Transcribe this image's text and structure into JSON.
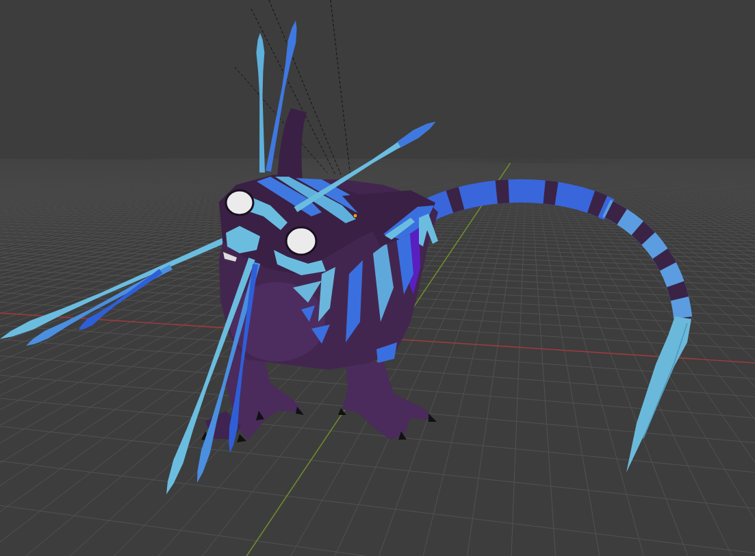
{
  "viewport": {
    "grid": true,
    "axes": {
      "x": true,
      "y": true
    },
    "origin_marker": true
  }
}
